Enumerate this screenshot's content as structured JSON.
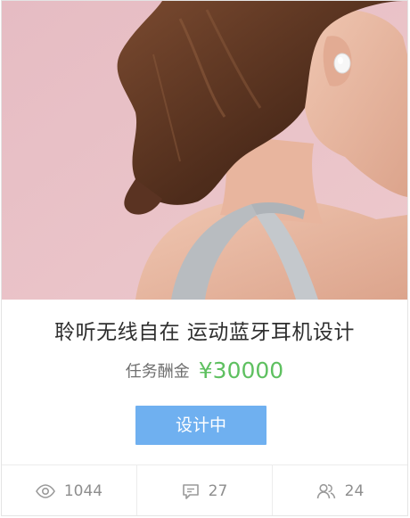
{
  "card": {
    "title": "聆听无线自在 运动蓝牙耳机设计",
    "reward_label": "任务酬金",
    "reward_value": "¥30000",
    "status_button": "设计中",
    "image_subject": "woman wearing wireless earbud",
    "colors": {
      "accent_green": "#5ec060",
      "button_blue": "#6fb0f0",
      "hero_background": "#e9c3c8"
    }
  },
  "stats": {
    "views": {
      "icon": "eye-icon",
      "value": "1044"
    },
    "comments": {
      "icon": "comment-icon",
      "value": "27"
    },
    "participants": {
      "icon": "users-icon",
      "value": "24"
    }
  }
}
